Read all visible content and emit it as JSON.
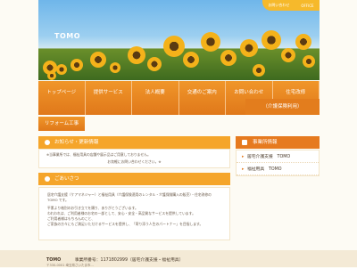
{
  "header": {
    "logo": "TOMO",
    "top_right": [
      "お問い合わせ",
      "OFFICE"
    ]
  },
  "nav": {
    "items": [
      "トップページ",
      "提供サービス",
      "法人概要",
      "交通のご案内",
      "お問い合わせ"
    ],
    "last_item": "住宅改修",
    "sub_label": "（介護保険利用）",
    "row2": "リフォーム工事"
  },
  "news": {
    "title": "お知らせ・更新情報",
    "line1": "※当事業所では、福祉用具の店舗や展示品はご用意しておりません。",
    "line2": "お気軽にお問い合わせください。※"
  },
  "greeting": {
    "title": "ごあいさつ",
    "p1": "居宅介護支援（ケアマネジャー）と福祉用具（介護保険適用のレンタル・介護保険購入の販売）・住宅改修の TOMO です。",
    "p2": "平素より格別のお引き立てを賜り、ありがとうございます。",
    "p3": "われわれは、ご利用者様のお宅の一部として、安心・安全・高品質なサービスを提供しています。",
    "p4": "ご利用者様はもちろんのこと、",
    "p5": "ご家族の方々にもご満足いただけるサービスを提供し、「寄り添う人生のパートナー」を目指します。"
  },
  "sidebar": {
    "title": "事業所情報",
    "items": [
      "居宅介護支援　TOMO",
      "福祉用具　TOMO"
    ]
  },
  "footer": {
    "name": "TOMO",
    "info": "事業所番号：1171802999（居宅介護支援・福祉用具）",
    "address": "〒330-0001 埼玉県さいたま市..."
  }
}
